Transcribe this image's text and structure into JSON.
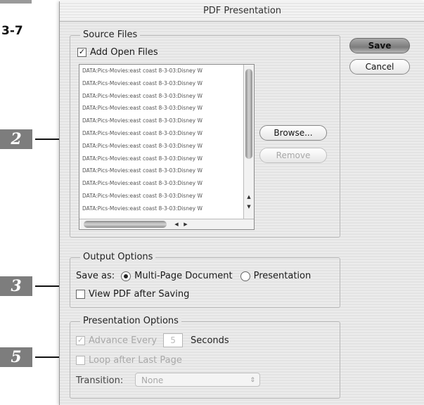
{
  "figure": {
    "label": "3-7"
  },
  "callouts": [
    "2",
    "3",
    "5"
  ],
  "dialog": {
    "title": "PDF Presentation",
    "save_label": "Save",
    "cancel_label": "Cancel"
  },
  "source_files": {
    "title": "Source Files",
    "add_open_files": {
      "label": "Add Open Files",
      "checked": true,
      "mark": "✓"
    },
    "items": [
      "DATA:Pics-Movies:east coast 8-3-03:Disney W",
      "DATA:Pics-Movies:east coast 8-3-03:Disney W",
      "DATA:Pics-Movies:east coast 8-3-03:Disney W",
      "DATA:Pics-Movies:east coast 8-3-03:Disney W",
      "DATA:Pics-Movies:east coast 8-3-03:Disney W",
      "DATA:Pics-Movies:east coast 8-3-03:Disney W",
      "DATA:Pics-Movies:east coast 8-3-03:Disney W",
      "DATA:Pics-Movies:east coast 8-3-03:Disney W",
      "DATA:Pics-Movies:east coast 8-3-03:Disney W",
      "DATA:Pics-Movies:east coast 8-3-03:Disney W",
      "DATA:Pics-Movies:east coast 8-3-03:Disney W",
      "DATA:Pics-Movies:east coast 8-3-03:Disney W",
      "DATA:Pics-Movies:east coast 8-3-03:Disney W",
      "DATA:Pics-Movies:east coast 8-3-03:Disney W"
    ],
    "browse_label": "Browse...",
    "remove_label": "Remove"
  },
  "output_options": {
    "title": "Output Options",
    "save_as_label": "Save as:",
    "multi_page_label": "Multi-Page Document",
    "presentation_label": "Presentation",
    "selected": "Multi-Page Document",
    "view_pdf_label": "View PDF after Saving",
    "view_pdf_checked": false
  },
  "presentation_options": {
    "title": "Presentation Options",
    "advance_every_label": "Advance Every",
    "advance_mark": "✓",
    "advance_value": "5",
    "seconds_label": "Seconds",
    "loop_label": "Loop after Last Page",
    "transition_label": "Transition:",
    "transition_value": "None",
    "transition_caret": "⇕"
  },
  "icons": {
    "up": "▲",
    "down": "▼",
    "left": "◀",
    "right": "▶"
  },
  "colors": {
    "callout_bg": "#7d7d7d",
    "default_button": "#8c8c8c"
  }
}
